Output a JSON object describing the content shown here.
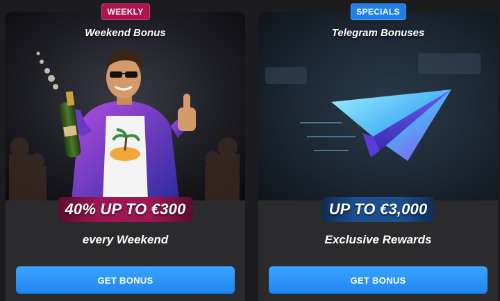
{
  "cards": [
    {
      "badge": "WEEKLY",
      "title": "Weekend Bonus",
      "amount": "40% UP TO €300",
      "subtitle": "every Weekend",
      "button": "GET BONUS",
      "accent": "#b0124f",
      "hero_icon": "champagne-man-illustration"
    },
    {
      "badge": "SPECIALS",
      "title": "Telegram Bonuses",
      "amount": "UP TO €3,000",
      "subtitle": "Exclusive Rewards",
      "button": "GET BONUS",
      "accent": "#1f80ea",
      "hero_icon": "paper-plane-icon"
    }
  ],
  "button_color": "#2b95fb"
}
